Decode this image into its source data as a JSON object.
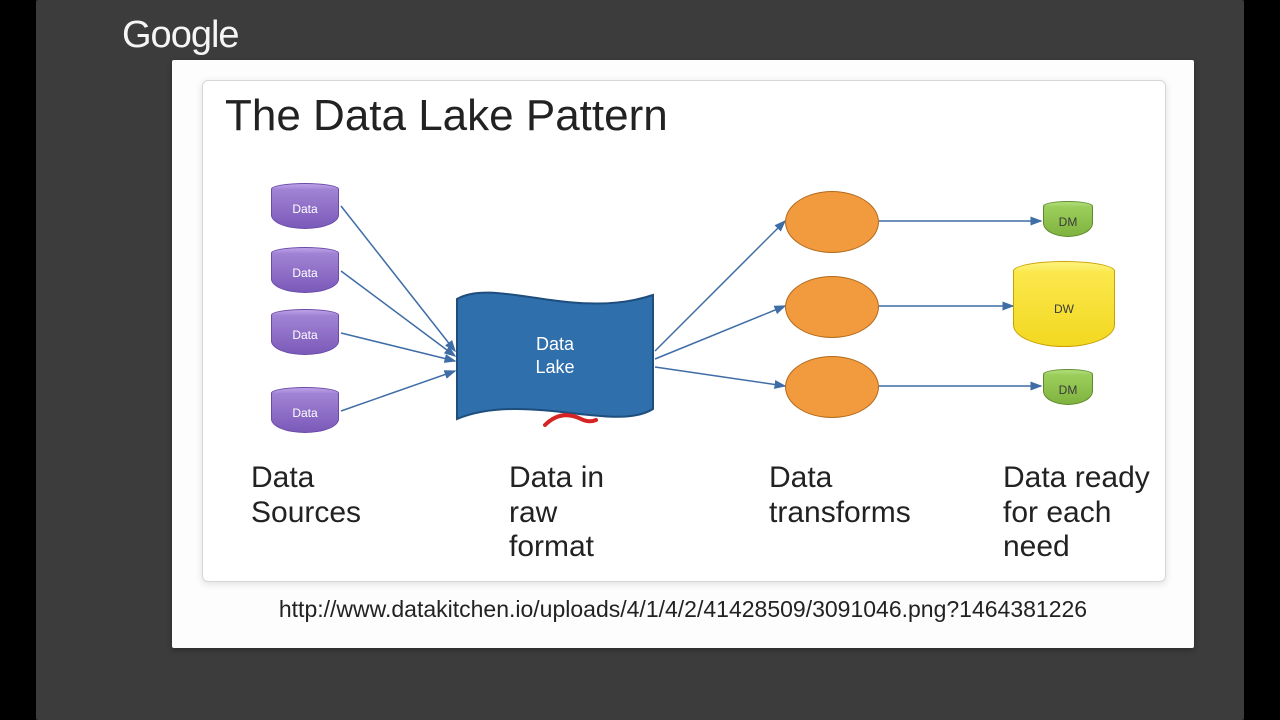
{
  "watermark": "Google",
  "slide": {
    "title": "The Data Lake Pattern",
    "source_caption": "http://www.datakitchen.io/uploads/4/1/4/2/41428509/3091046.png?1464381226",
    "columns": {
      "sources": "Data Sources",
      "raw": "Data in raw format",
      "transforms": "Data transforms",
      "ready": "Data ready for each need"
    },
    "nodes": {
      "source_label": "Data",
      "lake_label_line1": "Data",
      "lake_label_line2": "Lake",
      "dm_label": "DM",
      "dw_label": "DW"
    }
  },
  "colors": {
    "purple": "#8d6ccb",
    "blue": "#2f6fac",
    "orange": "#f29a3e",
    "green": "#8cc24d",
    "yellow": "#f6e239"
  }
}
